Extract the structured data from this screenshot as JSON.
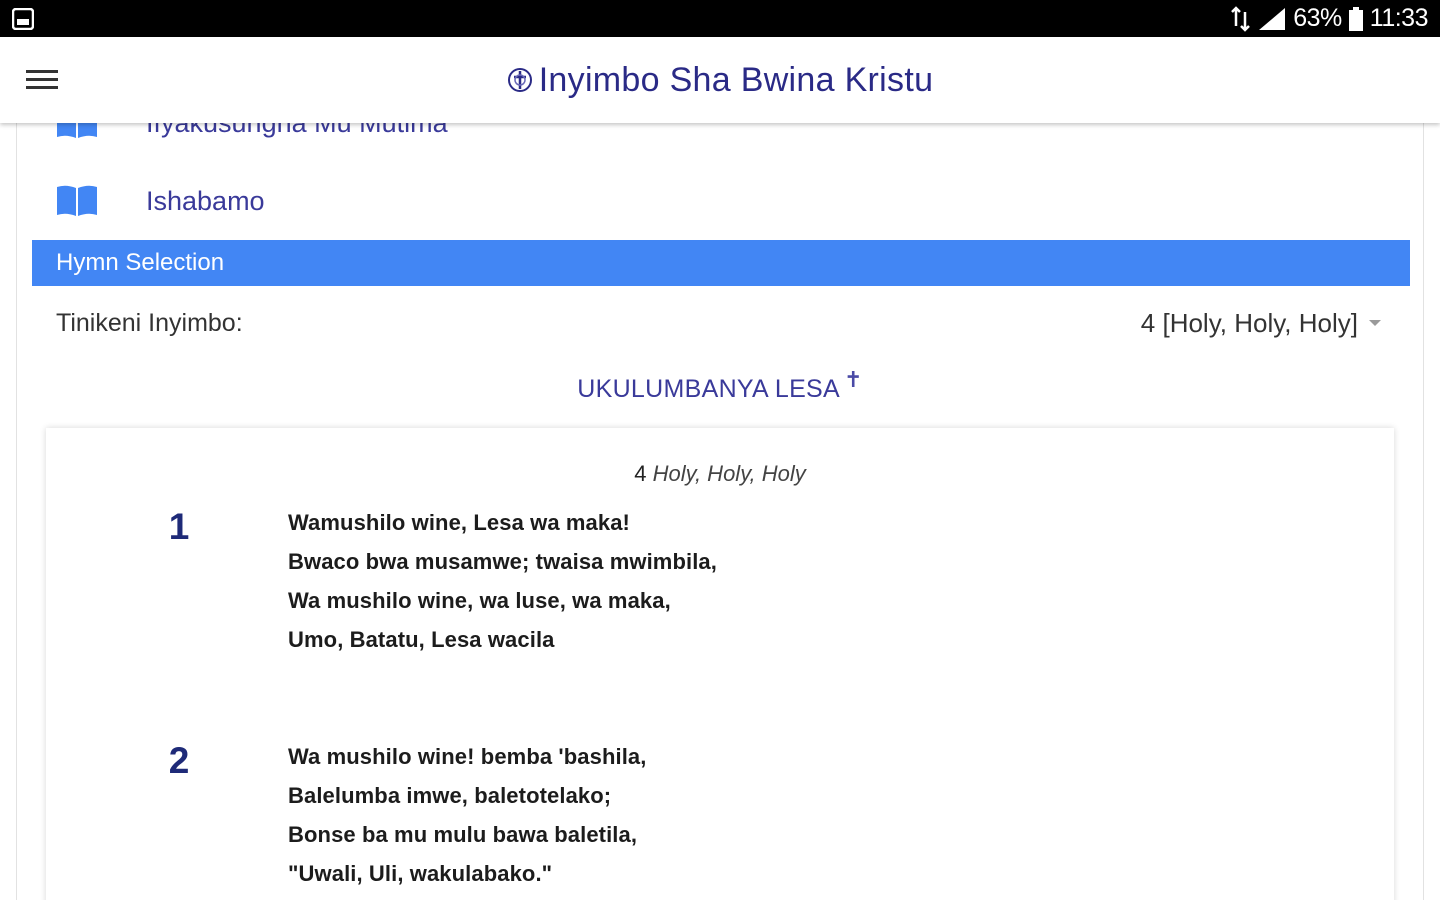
{
  "status_bar": {
    "battery_percent": "63%",
    "time": "11:33"
  },
  "toolbar": {
    "title": "Inyimbo Sha Bwina Kristu"
  },
  "books": [
    {
      "label": "Ifyakusungha Mu Mutima"
    },
    {
      "label": "Ishabamo"
    }
  ],
  "section": {
    "header": "Hymn Selection",
    "select_label": "Tinikeni Inyimbo:",
    "selected_hymn": "4 [Holy, Holy, Holy]"
  },
  "category": {
    "title": "UKULUMBANYA LESA",
    "symbol": "✝"
  },
  "hymn": {
    "number": "4",
    "name": "Holy, Holy, Holy",
    "verses": [
      {
        "number": "1",
        "lines": [
          "Wamushilo wine, Lesa wa maka!",
          "Bwaco bwa musamwe; twaisa mwimbila,",
          "Wa mushilo wine, wa luse, wa maka,",
          "Umo, Batatu, Lesa wacila"
        ]
      },
      {
        "number": "2",
        "lines": [
          "Wa mushilo wine! bemba 'bashila,",
          "Balelumba imwe, baletotelako;",
          "Bonse ba mu mulu bawa baletila,",
          "\"Uwali, Uli, wakulabako.\""
        ]
      }
    ]
  },
  "colors": {
    "accent": "#4286f4",
    "title": "#2a2a86",
    "verse_number": "#1e2a78"
  }
}
